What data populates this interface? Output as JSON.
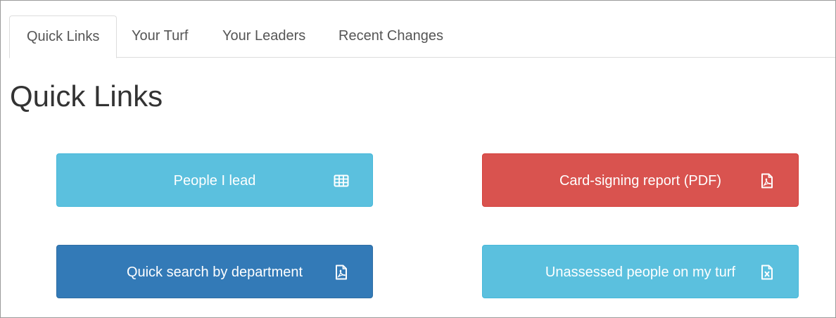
{
  "tabs": [
    {
      "label": "Quick Links",
      "active": true
    },
    {
      "label": "Your Turf",
      "active": false
    },
    {
      "label": "Your Leaders",
      "active": false
    },
    {
      "label": "Recent Changes",
      "active": false
    }
  ],
  "page": {
    "title": "Quick Links"
  },
  "quick_links": [
    {
      "label": "People I lead",
      "icon": "table-grid-icon",
      "color": "#5bc0de"
    },
    {
      "label": "Card-signing report (PDF)",
      "icon": "pdf-file-icon",
      "color": "#d9534f"
    },
    {
      "label": "Quick search by department",
      "icon": "pdf-file-icon",
      "color": "#337ab7"
    },
    {
      "label": "Unassessed people on my turf",
      "icon": "excel-file-icon",
      "color": "#5bc0de"
    }
  ]
}
